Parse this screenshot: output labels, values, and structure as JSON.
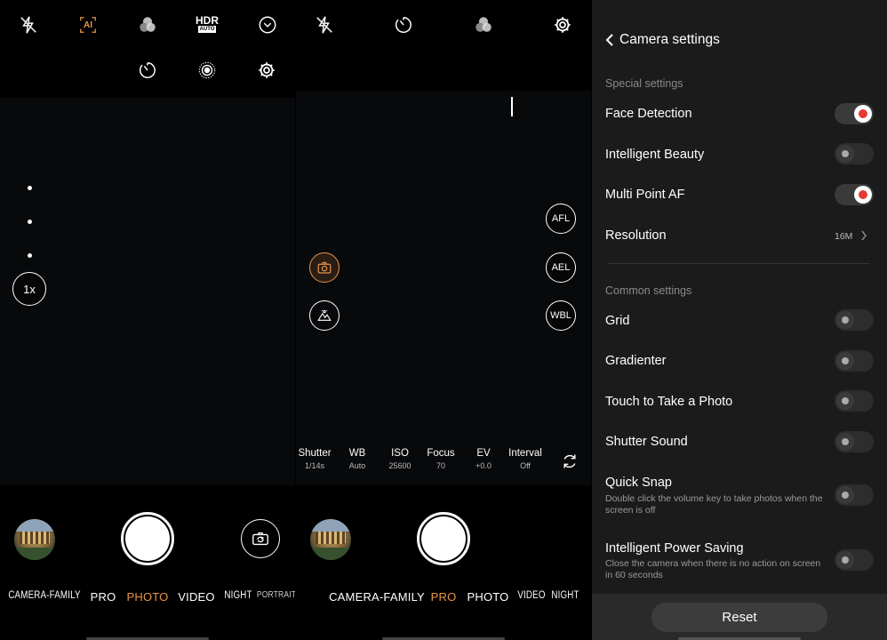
{
  "colors": {
    "accent": "#e8954a",
    "toggle_on_dot": "#e53935",
    "viewfinder": "#08090b"
  },
  "panel1": {
    "top_icons": [
      "flash-off-icon",
      "ai-icon",
      "filter-icon",
      "hdr-auto-icon",
      "expand-chevron-icon",
      "timer-icon",
      "live-photo-icon",
      "settings-gear-icon"
    ],
    "hdr_label": "HDR",
    "hdr_sub": "AUTO",
    "ai_label": "AI",
    "zoom": "1x",
    "modes": [
      "CAMERA-FAMILY",
      "PRO",
      "PHOTO",
      "VIDEO",
      "NIGHT",
      "PORTRAIT"
    ],
    "active_mode": "PHOTO"
  },
  "panel2": {
    "top_icons": [
      "flash-off-icon",
      "timer-icon",
      "filter-icon",
      "settings-gear-icon"
    ],
    "lock_buttons": [
      "AFL",
      "AEL",
      "WBL"
    ],
    "params": [
      {
        "label": "Shutter",
        "value": "1/14s"
      },
      {
        "label": "WB",
        "value": "Auto"
      },
      {
        "label": "ISO",
        "value": "25600"
      },
      {
        "label": "Focus",
        "value": "70"
      },
      {
        "label": "EV",
        "value": "+0.0"
      },
      {
        "label": "Interval",
        "value": "Off"
      }
    ],
    "modes": [
      "CAMERA-FAMILY",
      "PRO",
      "PHOTO",
      "VIDEO",
      "NIGHT"
    ],
    "active_mode": "PRO"
  },
  "settings": {
    "title": "Camera settings",
    "special_title": "Special settings",
    "common_title": "Common settings",
    "face_detection": {
      "label": "Face Detection",
      "on": true
    },
    "intelligent_beauty": {
      "label": "Intelligent Beauty",
      "on": false
    },
    "multi_point_af": {
      "label": "Multi Point AF",
      "on": true
    },
    "resolution": {
      "label": "Resolution",
      "value": "16M"
    },
    "grid": {
      "label": "Grid",
      "on": false
    },
    "gradienter": {
      "label": "Gradienter",
      "on": false
    },
    "touch_photo": {
      "label": "Touch to Take a Photo",
      "on": false
    },
    "shutter_sound": {
      "label": "Shutter Sound",
      "on": false
    },
    "quick_snap": {
      "label": "Quick Snap",
      "desc": "Double click the volume key to take photos when the screen is off",
      "on": false
    },
    "power_saving": {
      "label": "Intelligent Power Saving",
      "desc": "Close the camera when there is no action on screen in 60 seconds",
      "on": false
    },
    "reset_label": "Reset"
  }
}
